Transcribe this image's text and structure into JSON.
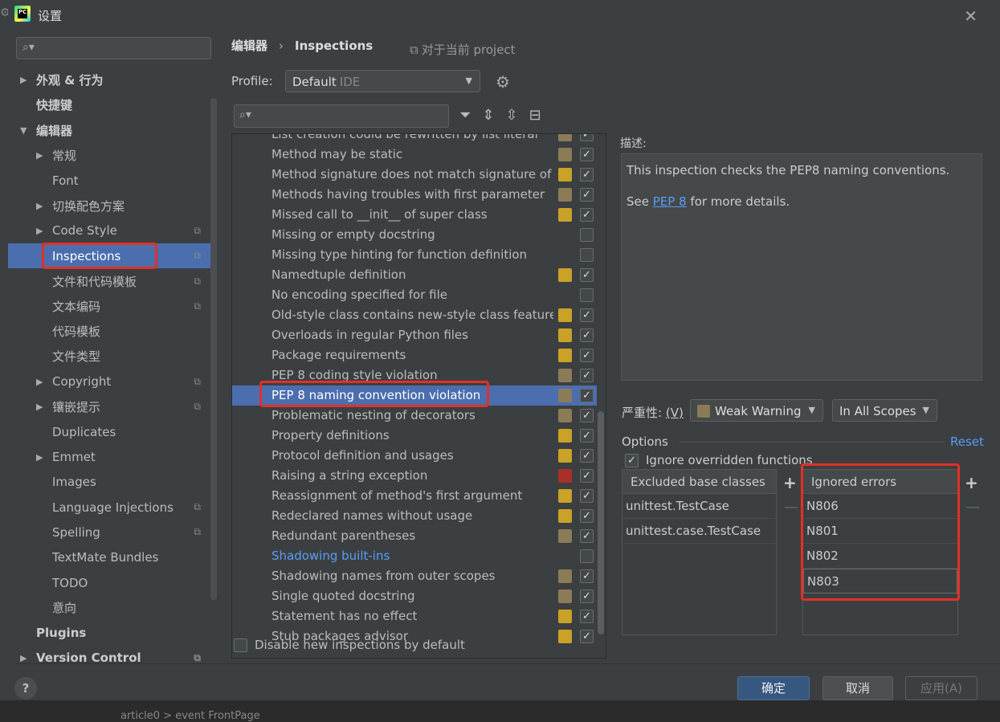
{
  "window": {
    "title": "设置"
  },
  "sidebar": {
    "items": [
      {
        "label": "外观 & 行为",
        "arrow": "▶",
        "level": 0,
        "bold": true
      },
      {
        "label": "快捷键",
        "arrow": "",
        "level": 0,
        "bold": true
      },
      {
        "label": "编辑器",
        "arrow": "▼",
        "level": 0,
        "bold": true
      },
      {
        "label": "常规",
        "arrow": "▶",
        "level": 1
      },
      {
        "label": "Font",
        "arrow": "",
        "level": 1
      },
      {
        "label": "切换配色方案",
        "arrow": "▶",
        "level": 1
      },
      {
        "label": "Code Style",
        "arrow": "▶",
        "level": 1,
        "copy": true
      },
      {
        "label": "Inspections",
        "arrow": "",
        "level": 1,
        "copy": true,
        "selected": true
      },
      {
        "label": "文件和代码模板",
        "arrow": "",
        "level": 1,
        "copy": true
      },
      {
        "label": "文本编码",
        "arrow": "",
        "level": 1,
        "copy": true
      },
      {
        "label": "代码模板",
        "arrow": "",
        "level": 1
      },
      {
        "label": "文件类型",
        "arrow": "",
        "level": 1
      },
      {
        "label": "Copyright",
        "arrow": "▶",
        "level": 1,
        "copy": true
      },
      {
        "label": "镶嵌提示",
        "arrow": "▶",
        "level": 1,
        "copy": true
      },
      {
        "label": "Duplicates",
        "arrow": "",
        "level": 1
      },
      {
        "label": "Emmet",
        "arrow": "▶",
        "level": 1
      },
      {
        "label": "Images",
        "arrow": "",
        "level": 1
      },
      {
        "label": "Language Injections",
        "arrow": "",
        "level": 1,
        "copy": true
      },
      {
        "label": "Spelling",
        "arrow": "",
        "level": 1,
        "copy": true
      },
      {
        "label": "TextMate Bundles",
        "arrow": "",
        "level": 1
      },
      {
        "label": "TODO",
        "arrow": "",
        "level": 1
      },
      {
        "label": "意向",
        "arrow": "",
        "level": 1
      },
      {
        "label": "Plugins",
        "arrow": "",
        "level": 0,
        "bold": true
      },
      {
        "label": "Version Control",
        "arrow": "▶",
        "level": 0,
        "bold": true,
        "copy": true
      }
    ]
  },
  "breadcrumb": {
    "root": "编辑器",
    "sep": "›",
    "current": "Inspections"
  },
  "project_note": {
    "icon": "⧉",
    "text": "对于当前 project"
  },
  "profile": {
    "label": "Profile:",
    "value": "Default",
    "scope": "IDE"
  },
  "inspections": [
    {
      "name": "List creation could be rewritten by list literal",
      "sev": "#8b7b57",
      "checked": true
    },
    {
      "name": "Method may be static",
      "sev": "#8b7b57",
      "checked": true
    },
    {
      "name": "Method signature does not match signature of overridden method",
      "sev": "#c9a227",
      "checked": true
    },
    {
      "name": "Methods having troubles with first parameter",
      "sev": "#8b7b57",
      "checked": true
    },
    {
      "name": "Missed call to __init__ of super class",
      "sev": "#c9a227",
      "checked": true
    },
    {
      "name": "Missing or empty docstring",
      "sev": "",
      "checked": false
    },
    {
      "name": "Missing type hinting for function definition",
      "sev": "",
      "checked": false
    },
    {
      "name": "Namedtuple definition",
      "sev": "#c9a227",
      "checked": true
    },
    {
      "name": "No encoding specified for file",
      "sev": "",
      "checked": false
    },
    {
      "name": "Old-style class contains new-style class features",
      "sev": "#c9a227",
      "checked": true
    },
    {
      "name": "Overloads in regular Python files",
      "sev": "#c9a227",
      "checked": true
    },
    {
      "name": "Package requirements",
      "sev": "#c9a227",
      "checked": true
    },
    {
      "name": "PEP 8 coding style violation",
      "sev": "#8b7b57",
      "checked": true
    },
    {
      "name": "PEP 8 naming convention violation",
      "sev": "#8b7b57",
      "checked": true,
      "selected": true
    },
    {
      "name": "Problematic nesting of decorators",
      "sev": "#8b7b57",
      "checked": true
    },
    {
      "name": "Property definitions",
      "sev": "#c9a227",
      "checked": true
    },
    {
      "name": "Protocol definition and usages",
      "sev": "#c9a227",
      "checked": true
    },
    {
      "name": "Raising a string exception",
      "sev": "#a92f2a",
      "checked": true
    },
    {
      "name": "Reassignment of method's first argument",
      "sev": "#c9a227",
      "checked": true
    },
    {
      "name": "Redeclared names without usage",
      "sev": "#c9a227",
      "checked": true
    },
    {
      "name": "Redundant parentheses",
      "sev": "#8b7b57",
      "checked": true
    },
    {
      "name": "Shadowing built-ins",
      "sev": "",
      "checked": false,
      "blue": true
    },
    {
      "name": "Shadowing names from outer scopes",
      "sev": "#8b7b57",
      "checked": true
    },
    {
      "name": "Single quoted docstring",
      "sev": "#8b7b57",
      "checked": true
    },
    {
      "name": "Statement has no effect",
      "sev": "#c9a227",
      "checked": true
    },
    {
      "name": "Stub packages advisor",
      "sev": "#c9a227",
      "checked": true
    }
  ],
  "disable_new": {
    "label": "Disable new inspections by default",
    "checked": false
  },
  "description": {
    "label": "描述:",
    "line1": "This inspection checks the PEP8 naming conventions.",
    "see": "See ",
    "link": "PEP 8",
    "after": " for more details."
  },
  "severity": {
    "label": "严重性:",
    "hotkey": "(V)",
    "value": "Weak Warning",
    "scope": "In All Scopes"
  },
  "options": {
    "label": "Options",
    "reset": "Reset",
    "ignore_overridden": "Ignore overridden functions",
    "ignore_checked": true
  },
  "excluded": {
    "header": "Excluded base classes",
    "rows": [
      "unittest.TestCase",
      "unittest.case.TestCase"
    ]
  },
  "ignored": {
    "header": "Ignored errors",
    "rows": [
      "N806",
      "N801",
      "N802",
      "N803"
    ]
  },
  "buttons": {
    "ok": "确定",
    "cancel": "取消",
    "apply": "应用(A)",
    "help": "?"
  },
  "statusbar": {
    "text": "article0 > event FrontPage"
  },
  "colors": {
    "accent": "#4b6eaf",
    "link": "#589df6",
    "highlight": "#e03127"
  }
}
